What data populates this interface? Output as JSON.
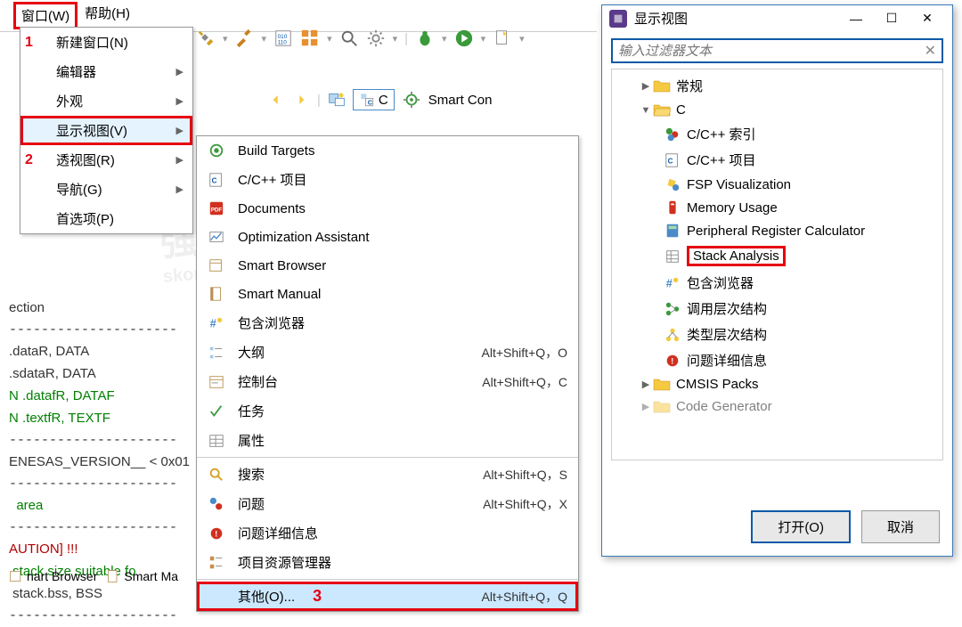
{
  "menubar": {
    "window": "窗口(W)",
    "help": "帮助(H)"
  },
  "dropdown": {
    "num1": "1",
    "num2": "2",
    "new_window": "新建窗口(N)",
    "editor": "编辑器",
    "appearance": "外观",
    "show_view": "显示视图(V)",
    "perspective": "透视图(R)",
    "navigation": "导航(G)",
    "preferences": "首选项(P)"
  },
  "toolbar": {
    "smart_conf": "Smart Con",
    "c_label": "C"
  },
  "submenu": {
    "items": [
      {
        "label": "Build Targets",
        "icon": "target"
      },
      {
        "label": "C/C++ 项目",
        "icon": "cproj"
      },
      {
        "label": "Documents",
        "icon": "pdf"
      },
      {
        "label": "Optimization Assistant",
        "icon": "opt"
      },
      {
        "label": "Smart Browser",
        "icon": "browser"
      },
      {
        "label": "Smart Manual",
        "icon": "manual"
      },
      {
        "label": "包含浏览器",
        "icon": "include"
      },
      {
        "label": "大纲",
        "icon": "outline",
        "shortcut": "Alt+Shift+Q，O"
      },
      {
        "label": "控制台",
        "icon": "console",
        "shortcut": "Alt+Shift+Q，C"
      },
      {
        "label": "任务",
        "icon": "task"
      },
      {
        "label": "属性",
        "icon": "props"
      },
      {
        "label": "搜索",
        "icon": "search",
        "shortcut": "Alt+Shift+Q，S"
      },
      {
        "label": "问题",
        "icon": "problem",
        "shortcut": "Alt+Shift+Q，X"
      },
      {
        "label": "问题详细信息",
        "icon": "problemdetail"
      },
      {
        "label": "项目资源管理器",
        "icon": "explorer"
      }
    ],
    "other": "其他(O)...",
    "other_num": "3",
    "other_shortcut": "Alt+Shift+Q，Q"
  },
  "code": {
    "l1": "ection",
    "l2": ".dataR, DATA",
    "l3": ".sdataR, DATA",
    "l4": "N .datafR, DATAF",
    "l5": "N .textfR, TEXTF",
    "l6": "ENESAS_VERSION__ < 0x01",
    "l7": "  area",
    "l8": "AUTION] !!!",
    "l9": " stack size suitable fo",
    "l10": " stack.bss, BSS"
  },
  "bottom": {
    "smart_browser": "nart Browser",
    "smart_manual": "Smart Ma"
  },
  "dialog": {
    "title": "显示视图",
    "filter_placeholder": "输入过滤器文本",
    "tree": {
      "general": "常规",
      "c": "C",
      "cpp_index": "C/C++ 索引",
      "cpp_project": "C/C++ 项目",
      "fsp": "FSP Visualization",
      "memory": "Memory Usage",
      "peripheral": "Peripheral Register Calculator",
      "stack": "Stack Analysis",
      "include_browser": "包含浏览器",
      "call_hierarchy": "调用层次结构",
      "type_hierarchy": "类型层次结构",
      "problem_detail": "问题详细信息",
      "cmsis": "CMSIS Packs",
      "codegen": "Code Generator"
    },
    "open": "打开(O)",
    "cancel": "取消"
  }
}
